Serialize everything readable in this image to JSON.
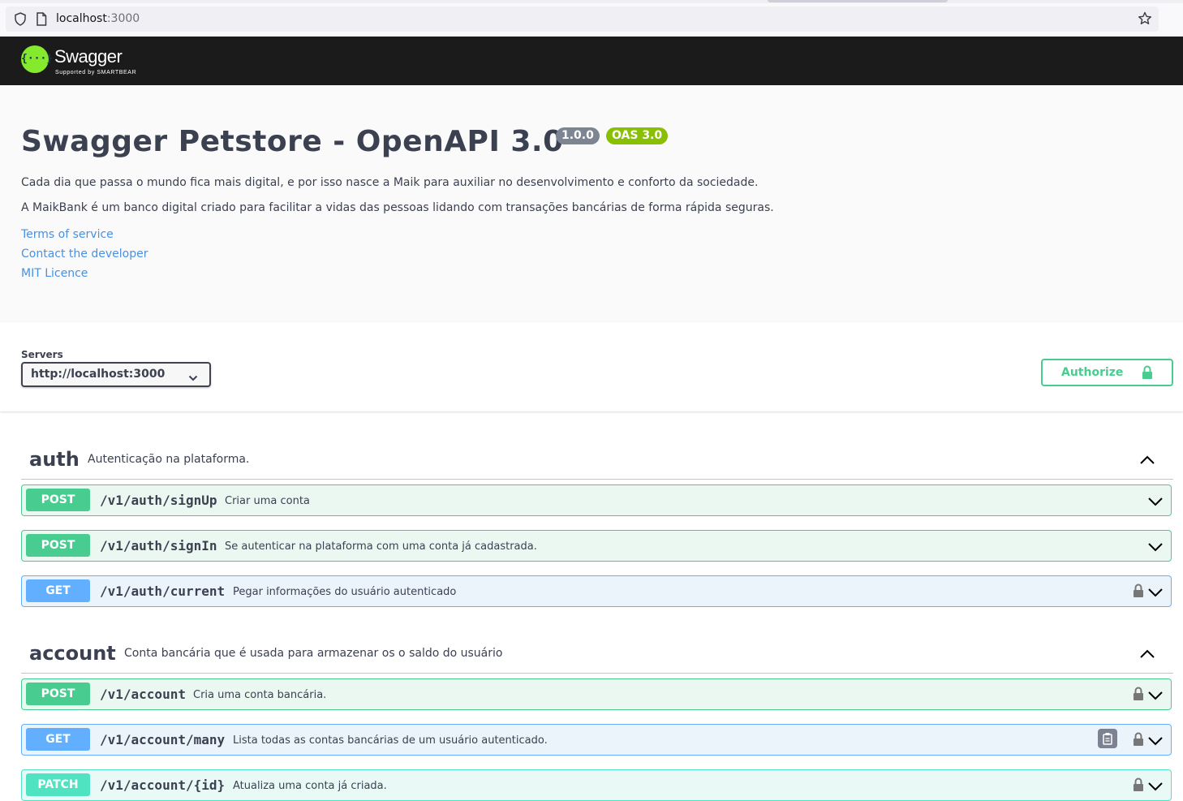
{
  "browser": {
    "url_host": "localhost",
    "url_port": ":3000"
  },
  "topbar": {
    "logo_text": "Swagger",
    "logo_sub": "Supported by SMARTBEAR",
    "logo_mark": "{···}"
  },
  "info": {
    "title": "Swagger Petstore - OpenAPI 3.0",
    "version_badge": "1.0.0",
    "oas_badge": "OAS 3.0",
    "description_1": "Cada dia que passa o mundo fica mais digital, e por isso nasce a Maik para auxiliar no desenvolvimento e conforto da sociedade.",
    "description_2": "A MaikBank é um banco digital criado para facilitar a vidas das pessoas lidando com transações bancárias de forma rápida seguras.",
    "links": [
      "Terms of service",
      "Contact the developer",
      "MIT Licence"
    ]
  },
  "scheme": {
    "servers_label": "Servers",
    "selected_server": "http://localhost:3000",
    "authorize_label": "Authorize"
  },
  "tags": [
    {
      "name": "auth",
      "description": "Autenticação na plataforma.",
      "operations": [
        {
          "method": "POST",
          "path": "/v1/auth/signUp",
          "summary": "Criar uma conta"
        },
        {
          "method": "POST",
          "path": "/v1/auth/signIn",
          "summary": "Se autenticar na plataforma com uma conta já cadastrada."
        },
        {
          "method": "GET",
          "path": "/v1/auth/current",
          "summary": "Pegar informações do usuário autenticado"
        }
      ]
    },
    {
      "name": "account",
      "description": "Conta bancária que é usada para armazenar os o saldo do usuário",
      "operations": [
        {
          "method": "POST",
          "path": "/v1/account",
          "summary": "Cria uma conta bancária."
        },
        {
          "method": "GET",
          "path": "/v1/account/many",
          "summary": "Lista todas as contas bancárias de um usuário autenticado."
        },
        {
          "method": "PATCH",
          "path": "/v1/account/{id}",
          "summary": "Atualiza uma conta já criada."
        }
      ]
    }
  ],
  "colors": {
    "post": "#49cc90",
    "get": "#61affe",
    "patch": "#50e3c2",
    "link": "#4990e2",
    "topbar": "#1b1b1b",
    "logo": "#85ea2d"
  },
  "icons": [
    "shield-icon",
    "page-icon",
    "star-icon",
    "chevron-down-icon",
    "chevron-up-icon",
    "lock-icon",
    "copy-icon"
  ]
}
